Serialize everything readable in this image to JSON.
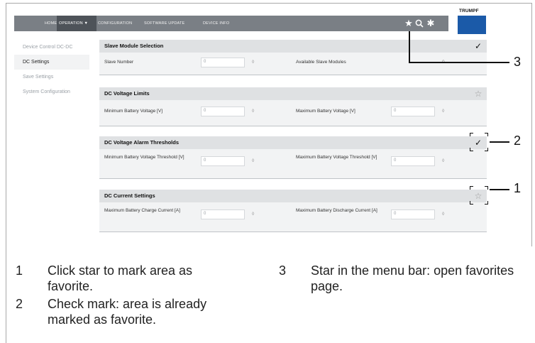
{
  "topbar": {
    "nav": [
      {
        "label": "HOME"
      },
      {
        "label": "OPERATION ▼"
      },
      {
        "label": "CONFIGURATION"
      },
      {
        "label": "SOFTWARE UPDATE"
      },
      {
        "label": "DEVICE INFO"
      }
    ],
    "icons": [
      "star-icon",
      "search-icon",
      "gear-icon"
    ]
  },
  "logo": {
    "text": "TRUMPF",
    "color": "#1b5aa8"
  },
  "sidebar": {
    "items": [
      {
        "label": "Device Control DC-DC",
        "active": false
      },
      {
        "label": "DC Settings",
        "active": true
      },
      {
        "label": "Save Settings",
        "active": false
      },
      {
        "label": "System Configuration",
        "active": false
      }
    ]
  },
  "panels": [
    {
      "title": "Slave Module Selection",
      "mark": "✓",
      "fields": [
        {
          "label": "Slave Number",
          "value": "0"
        },
        {
          "label": "Available Slave Modules",
          "value": "0"
        }
      ]
    },
    {
      "title": "DC Voltage Limits",
      "mark": "☆",
      "fields": [
        {
          "label": "Minimum Battery Voltage [V]",
          "value": "0"
        },
        {
          "label": "Maximum Battery Voltage [V]",
          "value": "0"
        }
      ]
    },
    {
      "title": "DC Voltage Alarm Thresholds",
      "mark": "✓",
      "fields": [
        {
          "label": "Minimum Battery Voltage Threshold [V]",
          "value": "0"
        },
        {
          "label": "Maximum Battery Voltage Threshold [V]",
          "value": "0"
        }
      ]
    },
    {
      "title": "DC Current Settings",
      "mark": "☆",
      "fields": [
        {
          "label": "Maximum Battery Charge Current [A]",
          "value": "0"
        },
        {
          "label": "Maximum Battery Discharge Current [A]",
          "value": "0"
        }
      ]
    }
  ],
  "callouts": [
    "1",
    "2",
    "3"
  ],
  "legend": [
    {
      "num": "1",
      "text": "Click star to mark area as favorite."
    },
    {
      "num": "2",
      "text": "Check mark: area is already marked as favorite."
    },
    {
      "num": "3",
      "text": "Star in the menu bar: open favorites page."
    }
  ]
}
